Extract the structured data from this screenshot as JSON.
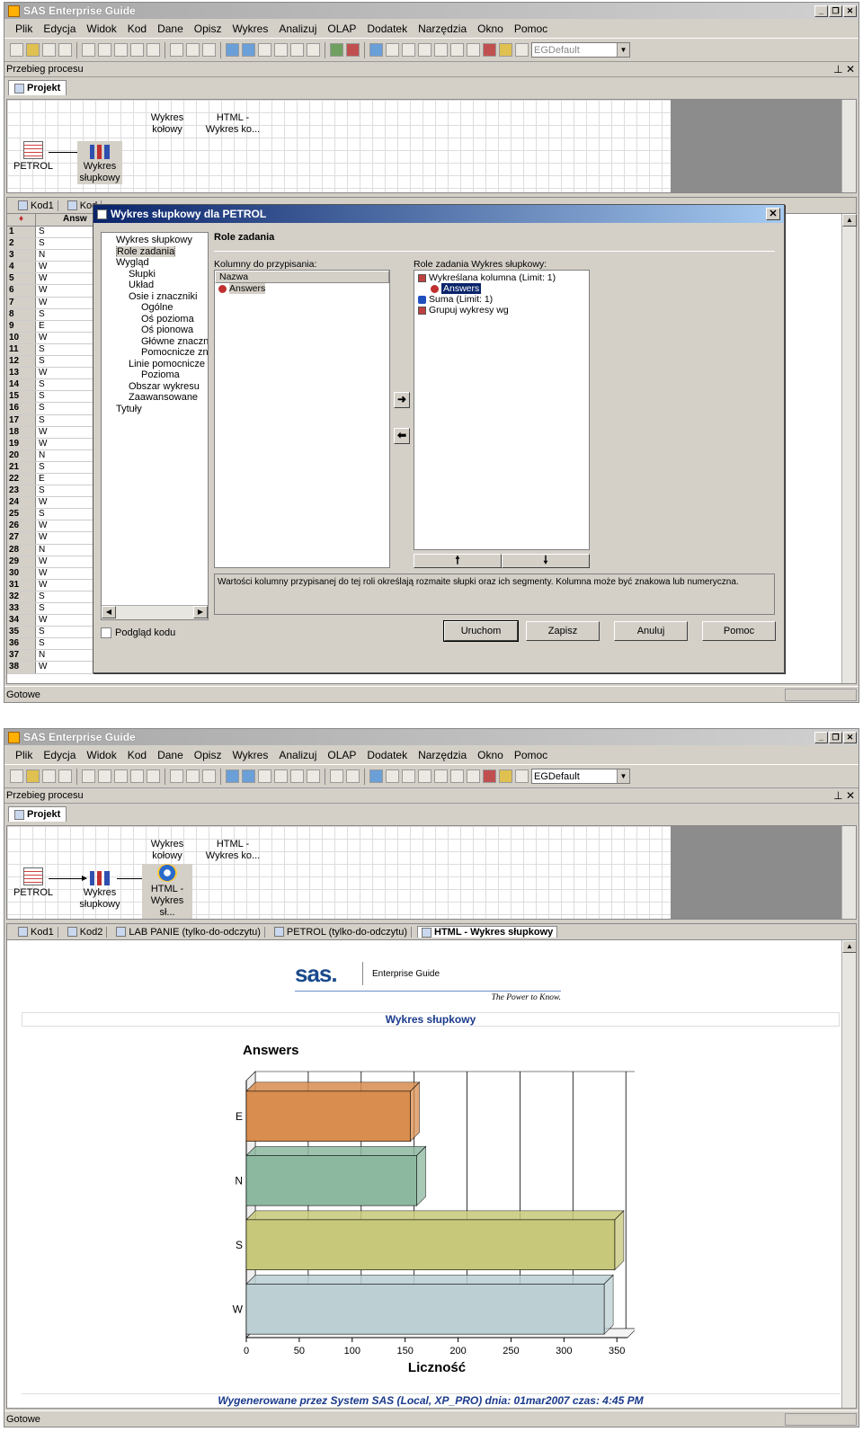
{
  "app": {
    "title": "SAS Enterprise Guide",
    "menu": [
      "Plik",
      "Edycja",
      "Widok",
      "Kod",
      "Dane",
      "Opisz",
      "Wykres",
      "Analizuj",
      "OLAP",
      "Dodatek",
      "Narzędzia",
      "Okno",
      "Pomoc"
    ],
    "combo_value": "EGDefault",
    "process_panel_title": "Przebieg procesu",
    "project_tab": "Projekt",
    "status_text": "Gotowe"
  },
  "flow": {
    "nodes": {
      "pie": "Wykres kołowy",
      "html_pie": "HTML - Wykres ko...",
      "petrol": "PETROL",
      "bar": "Wykres słupkowy",
      "html_bar": "HTML - Wykres sł..."
    }
  },
  "screen1": {
    "doc_tabs": [
      "Kod1",
      "Kod"
    ],
    "grid_header": "Answ",
    "rows": [
      "S",
      "S",
      "N",
      "W",
      "W",
      "W",
      "W",
      "S",
      "E",
      "W",
      "S",
      "S",
      "W",
      "S",
      "S",
      "S",
      "S",
      "W",
      "W",
      "N",
      "S",
      "E",
      "S",
      "W",
      "S",
      "W",
      "W",
      "N",
      "W",
      "W",
      "W",
      "S",
      "S",
      "W",
      "S",
      "S",
      "N",
      "W"
    ],
    "dialog": {
      "title": "Wykres słupkowy dla PETROL",
      "nav": [
        "Wykres słupkowy",
        "Role zadania",
        "Wygląd",
        "Słupki",
        "Układ",
        "Osie i znaczniki",
        "Ogólne",
        "Oś pozioma",
        "Oś pionowa",
        "Główne znaczni",
        "Pomocnicze zn",
        "Linie pomocnicze",
        "Pozioma",
        "Obszar wykresu",
        "Zaawansowane",
        "Tytuły"
      ],
      "section_title": "Role zadania",
      "columns_label": "Kolumny do przypisania:",
      "columns_header": "Nazwa",
      "columns": [
        "Answers"
      ],
      "roles_label": "Role zadania Wykres słupkowy:",
      "roles": {
        "plotted": "Wykreślana kolumna (Limit: 1)",
        "plotted_value": "Answers",
        "sum": "Suma (Limit: 1)",
        "group": "Grupuj wykresy wg"
      },
      "description": "Wartości kolumny przypisanej do tej roli określają rozmaite słupki oraz ich segmenty. Kolumna może być znakowa lub numeryczna.",
      "preview_label": "Podgląd kodu",
      "buttons": {
        "run": "Uruchom",
        "save": "Zapisz",
        "cancel": "Anuluj",
        "help": "Pomoc"
      }
    }
  },
  "screen2": {
    "doc_tabs": [
      "Kod1",
      "Kod2",
      "LAB PANIE (tylko-do-odczytu)",
      "PETROL (tylko-do-odczytu)",
      "HTML - Wykres słupkowy"
    ],
    "logo_enterprise": "Enterprise Guide",
    "logo_tagline": "The Power to Know.",
    "report_title": "Wykres słupkowy",
    "footer": "Wygenerowane przez System SAS (Local, XP_PRO) dnia: 01mar2007 czas: 4:45 PM"
  },
  "chart_data": {
    "type": "bar",
    "orientation": "horizontal",
    "title": "Answers",
    "xlabel": "Liczność",
    "categories": [
      "E",
      "N",
      "S",
      "W"
    ],
    "values": [
      155,
      161,
      348,
      338
    ],
    "xlim": [
      0,
      360
    ],
    "ticks": [
      0,
      50,
      100,
      150,
      200,
      250,
      300,
      350
    ],
    "colors": [
      "#d98d4e",
      "#8db8a0",
      "#c8c87a",
      "#bcd0d4"
    ],
    "grid": true
  }
}
